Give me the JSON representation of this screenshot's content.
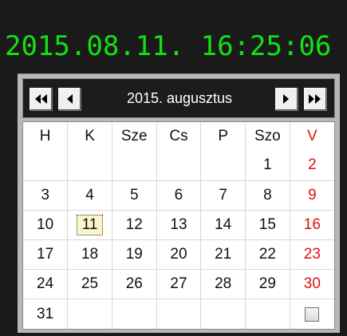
{
  "clock": {
    "datetime": "2015.08.11. 16:25:06",
    "color": "#14e014"
  },
  "nav": {
    "month_label": "2015. augusztus",
    "first_icon": "double-left-arrow-icon",
    "prev_icon": "left-arrow-icon",
    "next_icon": "right-arrow-icon",
    "last_icon": "double-right-arrow-icon"
  },
  "calendar": {
    "weekday_headers": [
      "H",
      "K",
      "Sze",
      "Cs",
      "P",
      "Szo",
      "V"
    ],
    "sunday_color": "#e01010",
    "selected_day": "11",
    "weeks": [
      [
        "",
        "",
        "",
        "",
        "",
        "1",
        "2"
      ],
      [
        "3",
        "4",
        "5",
        "6",
        "7",
        "8",
        "9"
      ],
      [
        "10",
        "11",
        "12",
        "13",
        "14",
        "15",
        "16"
      ],
      [
        "17",
        "18",
        "19",
        "20",
        "21",
        "22",
        "23"
      ],
      [
        "24",
        "25",
        "26",
        "27",
        "28",
        "29",
        "30"
      ],
      [
        "31",
        "",
        "",
        "",
        "",
        "",
        ""
      ]
    ],
    "checkbox_checked": false
  }
}
